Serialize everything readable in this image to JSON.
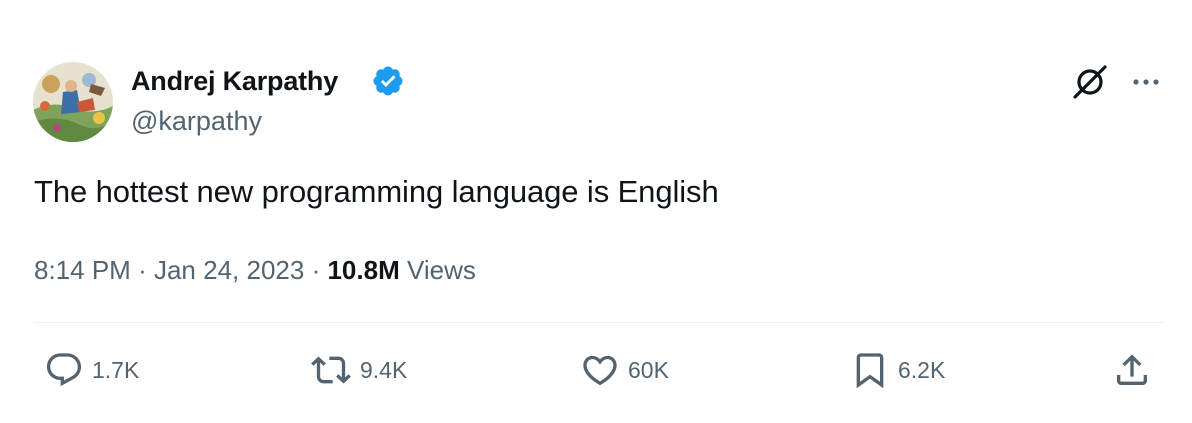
{
  "author": {
    "name": "Andrej Karpathy",
    "handle": "@karpathy",
    "verified": true
  },
  "tweet": {
    "text": "The hottest new programming language is English"
  },
  "meta": {
    "time": "8:14 PM",
    "separator": "·",
    "date": "Jan 24, 2023",
    "views_count": "10.8M",
    "views_label": "Views"
  },
  "actions": {
    "reply_count": "1.7K",
    "retweet_count": "9.4K",
    "like_count": "60K",
    "bookmark_count": "6.2K"
  },
  "icons": {
    "verified": "verified-badge-icon",
    "grok": "grok-icon",
    "more": "more-icon",
    "reply": "reply-icon",
    "retweet": "retweet-icon",
    "like": "heart-icon",
    "bookmark": "bookmark-icon",
    "share": "share-icon"
  },
  "colors": {
    "text_primary": "#0f1419",
    "text_secondary": "#536471",
    "verified_blue": "#1d9bf0",
    "divider": "#eff3f4"
  }
}
